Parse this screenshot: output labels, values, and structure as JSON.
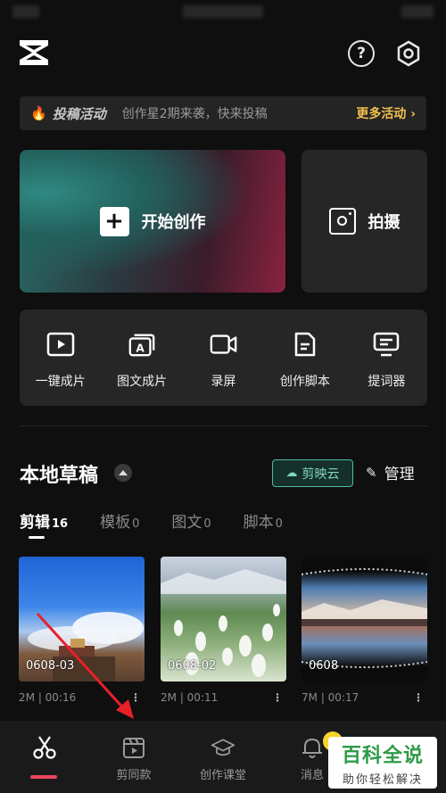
{
  "header": {
    "help_icon": "question-circle-icon",
    "settings_icon": "hexagon-settings-icon"
  },
  "promo": {
    "tag": "投稿活动",
    "text": "创作星2期来袭，快来投稿",
    "more": "更多活动 ›"
  },
  "start_create": {
    "label": "开始创作"
  },
  "shoot": {
    "label": "拍摄"
  },
  "tools": [
    {
      "label": "一键成片",
      "icon": "play-square-icon"
    },
    {
      "label": "图文成片",
      "icon": "text-to-video-icon"
    },
    {
      "label": "录屏",
      "icon": "video-camera-icon"
    },
    {
      "label": "创作脚本",
      "icon": "script-doc-icon"
    },
    {
      "label": "提词器",
      "icon": "teleprompter-icon"
    }
  ],
  "drafts": {
    "title": "本地草稿",
    "cloud_label": "剪映云",
    "manage_label": "管理"
  },
  "tabs": [
    {
      "label": "剪辑",
      "count": "16"
    },
    {
      "label": "模板",
      "count": "0"
    },
    {
      "label": "图文",
      "count": "0"
    },
    {
      "label": "脚本",
      "count": "0"
    }
  ],
  "projects": [
    {
      "name": "0608-03",
      "size": "2M",
      "duration": "00:16"
    },
    {
      "name": "0608-02",
      "size": "2M",
      "duration": "00:11"
    },
    {
      "name": "0608",
      "size": "7M",
      "duration": "00:17"
    }
  ],
  "bottom_nav": [
    {
      "label": "",
      "icon": "scissors-icon"
    },
    {
      "label": "剪同款",
      "icon": "clapperboard-icon"
    },
    {
      "label": "创作课堂",
      "icon": "graduation-cap-icon"
    },
    {
      "label": "消息",
      "icon": "bell-icon"
    }
  ],
  "watermark": {
    "big": "百科全说",
    "small": "助你轻松解决"
  }
}
